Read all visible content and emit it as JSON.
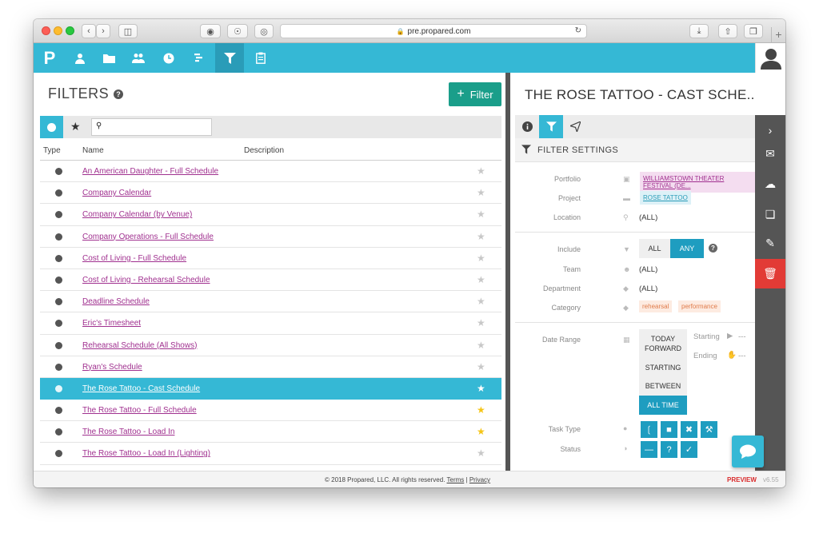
{
  "browser": {
    "url": "pre.propared.com"
  },
  "left": {
    "title": "FILTERS",
    "filter_button": "Filter",
    "search": {
      "value": "",
      "placeholder": ""
    },
    "columns": {
      "type": "Type",
      "name": "Name",
      "description": "Description"
    },
    "rows": [
      {
        "name": "An American Daughter - Full Schedule",
        "star": "plain"
      },
      {
        "name": "Company Calendar",
        "star": "plain"
      },
      {
        "name": "Company Calendar (by Venue)",
        "star": "plain"
      },
      {
        "name": "Company Operations - Full Schedule",
        "star": "plain"
      },
      {
        "name": "Cost of Living - Full Schedule",
        "star": "plain"
      },
      {
        "name": "Cost of Living - Rehearsal Schedule",
        "star": "plain"
      },
      {
        "name": "Deadline Schedule",
        "star": "plain"
      },
      {
        "name": "Eric's Timesheet",
        "star": "plain"
      },
      {
        "name": "Rehearsal Schedule (All Shows)",
        "star": "plain"
      },
      {
        "name": "Ryan's Schedule",
        "star": "plain"
      },
      {
        "name": "The Rose Tattoo - Cast Schedule",
        "star": "plain",
        "selected": true
      },
      {
        "name": "The Rose Tattoo - Full Schedule",
        "star": "gold"
      },
      {
        "name": "The Rose Tattoo - Load In",
        "star": "gold"
      },
      {
        "name": "The Rose Tattoo - Load In (Lighting)",
        "star": "plain"
      }
    ]
  },
  "right": {
    "title": "THE ROSE TATTOO - CAST SCHE...",
    "section_header": "FILTER SETTINGS",
    "fields": {
      "portfolio_label": "Portfolio",
      "portfolio_value": "WILLIAMSTOWN THEATER FESTIVAL (DE...",
      "project_label": "Project",
      "project_value": "ROSE TATTOO",
      "location_label": "Location",
      "location_value": "(ALL)",
      "include_label": "Include",
      "include_all": "ALL",
      "include_any": "ANY",
      "team_label": "Team",
      "team_value": "(ALL)",
      "department_label": "Department",
      "department_value": "(ALL)",
      "category_label": "Category",
      "category_tags": [
        "rehearsal",
        "performance"
      ],
      "date_range_label": "Date Range",
      "date_today": "TODAY FORWARD",
      "date_starting": "STARTING",
      "date_between": "BETWEEN",
      "date_all": "ALL TIME",
      "starting_label": "Starting",
      "starting_value": "---",
      "ending_label": "Ending",
      "ending_value": "---",
      "task_type_label": "Task Type",
      "status_label": "Status"
    }
  },
  "footer": {
    "copyright": "© 2018 Propared, LLC. All rights reserved.",
    "terms": "Terms",
    "sep": "|",
    "privacy": "Privacy",
    "preview": "PREVIEW",
    "version": "v6.55"
  },
  "colors": {
    "accent": "#35b8d5",
    "filter_button": "#1a9e8a",
    "link": "#a0308f",
    "danger": "#e23b36",
    "star_gold": "#f5c518"
  }
}
